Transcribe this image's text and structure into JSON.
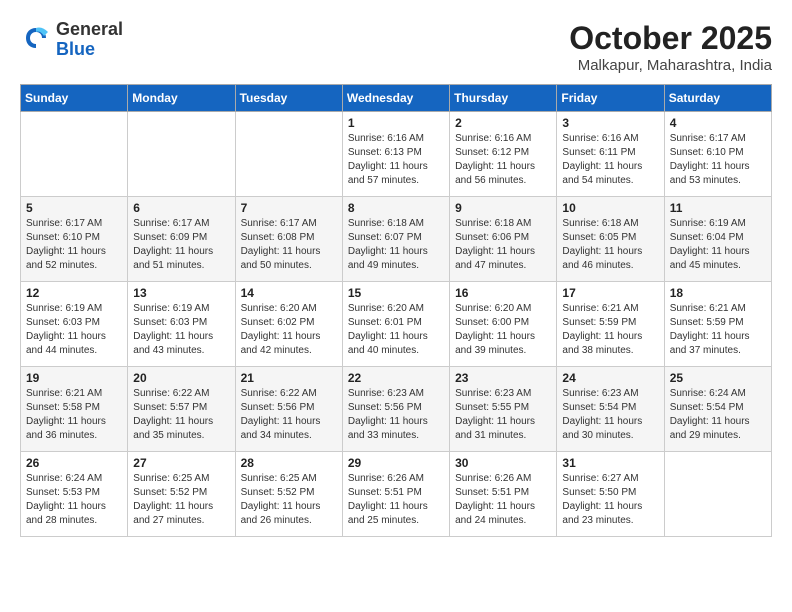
{
  "header": {
    "logo_line1": "General",
    "logo_line2": "Blue",
    "month_title": "October 2025",
    "subtitle": "Malkapur, Maharashtra, India"
  },
  "days_of_week": [
    "Sunday",
    "Monday",
    "Tuesday",
    "Wednesday",
    "Thursday",
    "Friday",
    "Saturday"
  ],
  "weeks": [
    [
      {
        "day": "",
        "info": ""
      },
      {
        "day": "",
        "info": ""
      },
      {
        "day": "",
        "info": ""
      },
      {
        "day": "1",
        "info": "Sunrise: 6:16 AM\nSunset: 6:13 PM\nDaylight: 11 hours\nand 57 minutes."
      },
      {
        "day": "2",
        "info": "Sunrise: 6:16 AM\nSunset: 6:12 PM\nDaylight: 11 hours\nand 56 minutes."
      },
      {
        "day": "3",
        "info": "Sunrise: 6:16 AM\nSunset: 6:11 PM\nDaylight: 11 hours\nand 54 minutes."
      },
      {
        "day": "4",
        "info": "Sunrise: 6:17 AM\nSunset: 6:10 PM\nDaylight: 11 hours\nand 53 minutes."
      }
    ],
    [
      {
        "day": "5",
        "info": "Sunrise: 6:17 AM\nSunset: 6:10 PM\nDaylight: 11 hours\nand 52 minutes."
      },
      {
        "day": "6",
        "info": "Sunrise: 6:17 AM\nSunset: 6:09 PM\nDaylight: 11 hours\nand 51 minutes."
      },
      {
        "day": "7",
        "info": "Sunrise: 6:17 AM\nSunset: 6:08 PM\nDaylight: 11 hours\nand 50 minutes."
      },
      {
        "day": "8",
        "info": "Sunrise: 6:18 AM\nSunset: 6:07 PM\nDaylight: 11 hours\nand 49 minutes."
      },
      {
        "day": "9",
        "info": "Sunrise: 6:18 AM\nSunset: 6:06 PM\nDaylight: 11 hours\nand 47 minutes."
      },
      {
        "day": "10",
        "info": "Sunrise: 6:18 AM\nSunset: 6:05 PM\nDaylight: 11 hours\nand 46 minutes."
      },
      {
        "day": "11",
        "info": "Sunrise: 6:19 AM\nSunset: 6:04 PM\nDaylight: 11 hours\nand 45 minutes."
      }
    ],
    [
      {
        "day": "12",
        "info": "Sunrise: 6:19 AM\nSunset: 6:03 PM\nDaylight: 11 hours\nand 44 minutes."
      },
      {
        "day": "13",
        "info": "Sunrise: 6:19 AM\nSunset: 6:03 PM\nDaylight: 11 hours\nand 43 minutes."
      },
      {
        "day": "14",
        "info": "Sunrise: 6:20 AM\nSunset: 6:02 PM\nDaylight: 11 hours\nand 42 minutes."
      },
      {
        "day": "15",
        "info": "Sunrise: 6:20 AM\nSunset: 6:01 PM\nDaylight: 11 hours\nand 40 minutes."
      },
      {
        "day": "16",
        "info": "Sunrise: 6:20 AM\nSunset: 6:00 PM\nDaylight: 11 hours\nand 39 minutes."
      },
      {
        "day": "17",
        "info": "Sunrise: 6:21 AM\nSunset: 5:59 PM\nDaylight: 11 hours\nand 38 minutes."
      },
      {
        "day": "18",
        "info": "Sunrise: 6:21 AM\nSunset: 5:59 PM\nDaylight: 11 hours\nand 37 minutes."
      }
    ],
    [
      {
        "day": "19",
        "info": "Sunrise: 6:21 AM\nSunset: 5:58 PM\nDaylight: 11 hours\nand 36 minutes."
      },
      {
        "day": "20",
        "info": "Sunrise: 6:22 AM\nSunset: 5:57 PM\nDaylight: 11 hours\nand 35 minutes."
      },
      {
        "day": "21",
        "info": "Sunrise: 6:22 AM\nSunset: 5:56 PM\nDaylight: 11 hours\nand 34 minutes."
      },
      {
        "day": "22",
        "info": "Sunrise: 6:23 AM\nSunset: 5:56 PM\nDaylight: 11 hours\nand 33 minutes."
      },
      {
        "day": "23",
        "info": "Sunrise: 6:23 AM\nSunset: 5:55 PM\nDaylight: 11 hours\nand 31 minutes."
      },
      {
        "day": "24",
        "info": "Sunrise: 6:23 AM\nSunset: 5:54 PM\nDaylight: 11 hours\nand 30 minutes."
      },
      {
        "day": "25",
        "info": "Sunrise: 6:24 AM\nSunset: 5:54 PM\nDaylight: 11 hours\nand 29 minutes."
      }
    ],
    [
      {
        "day": "26",
        "info": "Sunrise: 6:24 AM\nSunset: 5:53 PM\nDaylight: 11 hours\nand 28 minutes."
      },
      {
        "day": "27",
        "info": "Sunrise: 6:25 AM\nSunset: 5:52 PM\nDaylight: 11 hours\nand 27 minutes."
      },
      {
        "day": "28",
        "info": "Sunrise: 6:25 AM\nSunset: 5:52 PM\nDaylight: 11 hours\nand 26 minutes."
      },
      {
        "day": "29",
        "info": "Sunrise: 6:26 AM\nSunset: 5:51 PM\nDaylight: 11 hours\nand 25 minutes."
      },
      {
        "day": "30",
        "info": "Sunrise: 6:26 AM\nSunset: 5:51 PM\nDaylight: 11 hours\nand 24 minutes."
      },
      {
        "day": "31",
        "info": "Sunrise: 6:27 AM\nSunset: 5:50 PM\nDaylight: 11 hours\nand 23 minutes."
      },
      {
        "day": "",
        "info": ""
      }
    ]
  ]
}
